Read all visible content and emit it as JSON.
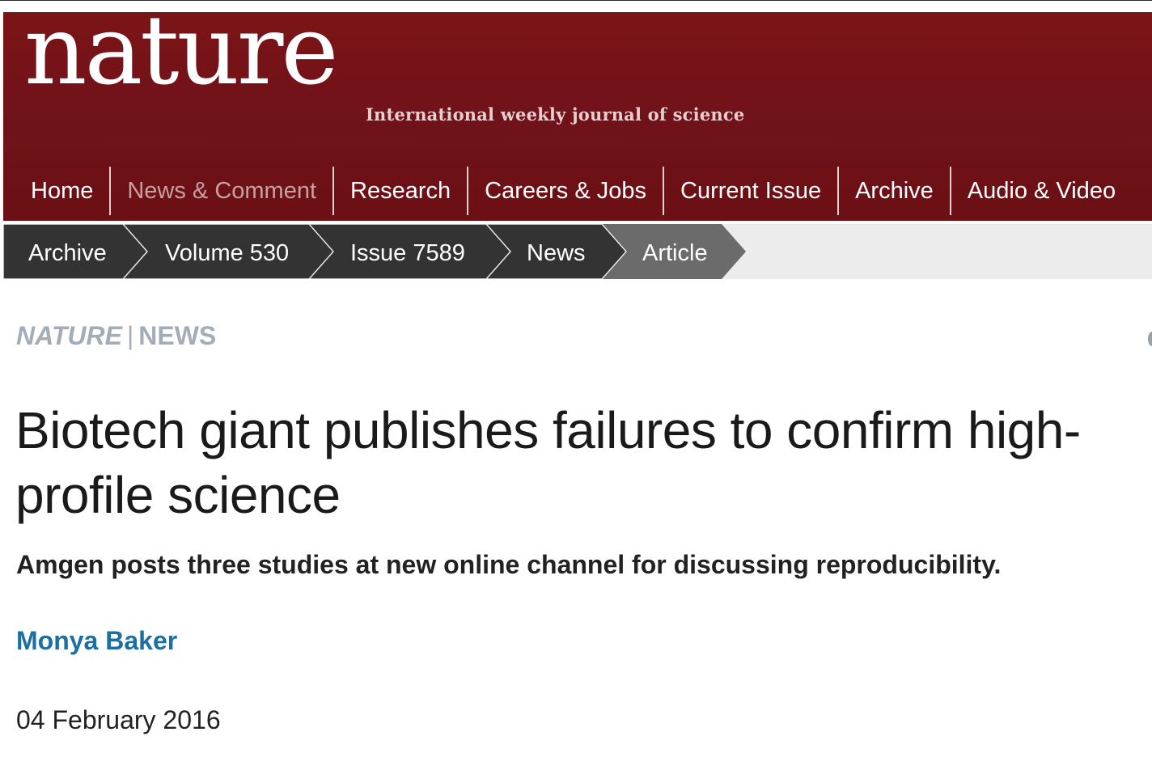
{
  "masthead": {
    "logo": "nature",
    "tagline": "International weekly journal of science"
  },
  "main_nav": {
    "items": [
      {
        "label": "Home",
        "active": false
      },
      {
        "label": "News & Comment",
        "active": true
      },
      {
        "label": "Research",
        "active": false
      },
      {
        "label": "Careers & Jobs",
        "active": false
      },
      {
        "label": "Current Issue",
        "active": false
      },
      {
        "label": "Archive",
        "active": false
      },
      {
        "label": "Audio & Video",
        "active": false
      }
    ]
  },
  "breadcrumb": {
    "items": [
      "Archive",
      "Volume 530",
      "Issue 7589",
      "News",
      "Article"
    ]
  },
  "article": {
    "journal": "NATURE",
    "separator": "|",
    "section": "NEWS",
    "title": "Biotech giant publishes failures to confirm high-profile science",
    "standfirst": "Amgen posts three studies at new online channel for discussing reproducibility.",
    "author": "Monya Baker",
    "date": "04 February 2016"
  },
  "colors": {
    "masthead_red": "#741318",
    "nav_active": "#c7a0a0",
    "crumb_dark": "#333333",
    "crumb_current": "#6b6b6b",
    "section_label": "#a3adb8",
    "author_link": "#1c6fa0"
  }
}
